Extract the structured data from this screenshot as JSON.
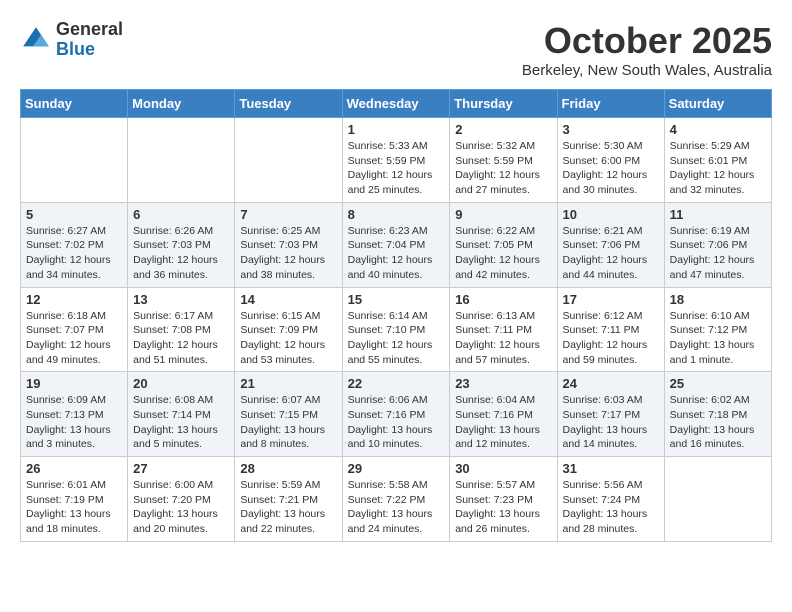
{
  "logo": {
    "general": "General",
    "blue": "Blue"
  },
  "title": "October 2025",
  "location": "Berkeley, New South Wales, Australia",
  "weekdays": [
    "Sunday",
    "Monday",
    "Tuesday",
    "Wednesday",
    "Thursday",
    "Friday",
    "Saturday"
  ],
  "weeks": [
    [
      {
        "day": "",
        "info": ""
      },
      {
        "day": "",
        "info": ""
      },
      {
        "day": "",
        "info": ""
      },
      {
        "day": "1",
        "info": "Sunrise: 5:33 AM\nSunset: 5:59 PM\nDaylight: 12 hours\nand 25 minutes."
      },
      {
        "day": "2",
        "info": "Sunrise: 5:32 AM\nSunset: 5:59 PM\nDaylight: 12 hours\nand 27 minutes."
      },
      {
        "day": "3",
        "info": "Sunrise: 5:30 AM\nSunset: 6:00 PM\nDaylight: 12 hours\nand 30 minutes."
      },
      {
        "day": "4",
        "info": "Sunrise: 5:29 AM\nSunset: 6:01 PM\nDaylight: 12 hours\nand 32 minutes."
      }
    ],
    [
      {
        "day": "5",
        "info": "Sunrise: 6:27 AM\nSunset: 7:02 PM\nDaylight: 12 hours\nand 34 minutes."
      },
      {
        "day": "6",
        "info": "Sunrise: 6:26 AM\nSunset: 7:03 PM\nDaylight: 12 hours\nand 36 minutes."
      },
      {
        "day": "7",
        "info": "Sunrise: 6:25 AM\nSunset: 7:03 PM\nDaylight: 12 hours\nand 38 minutes."
      },
      {
        "day": "8",
        "info": "Sunrise: 6:23 AM\nSunset: 7:04 PM\nDaylight: 12 hours\nand 40 minutes."
      },
      {
        "day": "9",
        "info": "Sunrise: 6:22 AM\nSunset: 7:05 PM\nDaylight: 12 hours\nand 42 minutes."
      },
      {
        "day": "10",
        "info": "Sunrise: 6:21 AM\nSunset: 7:06 PM\nDaylight: 12 hours\nand 44 minutes."
      },
      {
        "day": "11",
        "info": "Sunrise: 6:19 AM\nSunset: 7:06 PM\nDaylight: 12 hours\nand 47 minutes."
      }
    ],
    [
      {
        "day": "12",
        "info": "Sunrise: 6:18 AM\nSunset: 7:07 PM\nDaylight: 12 hours\nand 49 minutes."
      },
      {
        "day": "13",
        "info": "Sunrise: 6:17 AM\nSunset: 7:08 PM\nDaylight: 12 hours\nand 51 minutes."
      },
      {
        "day": "14",
        "info": "Sunrise: 6:15 AM\nSunset: 7:09 PM\nDaylight: 12 hours\nand 53 minutes."
      },
      {
        "day": "15",
        "info": "Sunrise: 6:14 AM\nSunset: 7:10 PM\nDaylight: 12 hours\nand 55 minutes."
      },
      {
        "day": "16",
        "info": "Sunrise: 6:13 AM\nSunset: 7:11 PM\nDaylight: 12 hours\nand 57 minutes."
      },
      {
        "day": "17",
        "info": "Sunrise: 6:12 AM\nSunset: 7:11 PM\nDaylight: 12 hours\nand 59 minutes."
      },
      {
        "day": "18",
        "info": "Sunrise: 6:10 AM\nSunset: 7:12 PM\nDaylight: 13 hours\nand 1 minute."
      }
    ],
    [
      {
        "day": "19",
        "info": "Sunrise: 6:09 AM\nSunset: 7:13 PM\nDaylight: 13 hours\nand 3 minutes."
      },
      {
        "day": "20",
        "info": "Sunrise: 6:08 AM\nSunset: 7:14 PM\nDaylight: 13 hours\nand 5 minutes."
      },
      {
        "day": "21",
        "info": "Sunrise: 6:07 AM\nSunset: 7:15 PM\nDaylight: 13 hours\nand 8 minutes."
      },
      {
        "day": "22",
        "info": "Sunrise: 6:06 AM\nSunset: 7:16 PM\nDaylight: 13 hours\nand 10 minutes."
      },
      {
        "day": "23",
        "info": "Sunrise: 6:04 AM\nSunset: 7:16 PM\nDaylight: 13 hours\nand 12 minutes."
      },
      {
        "day": "24",
        "info": "Sunrise: 6:03 AM\nSunset: 7:17 PM\nDaylight: 13 hours\nand 14 minutes."
      },
      {
        "day": "25",
        "info": "Sunrise: 6:02 AM\nSunset: 7:18 PM\nDaylight: 13 hours\nand 16 minutes."
      }
    ],
    [
      {
        "day": "26",
        "info": "Sunrise: 6:01 AM\nSunset: 7:19 PM\nDaylight: 13 hours\nand 18 minutes."
      },
      {
        "day": "27",
        "info": "Sunrise: 6:00 AM\nSunset: 7:20 PM\nDaylight: 13 hours\nand 20 minutes."
      },
      {
        "day": "28",
        "info": "Sunrise: 5:59 AM\nSunset: 7:21 PM\nDaylight: 13 hours\nand 22 minutes."
      },
      {
        "day": "29",
        "info": "Sunrise: 5:58 AM\nSunset: 7:22 PM\nDaylight: 13 hours\nand 24 minutes."
      },
      {
        "day": "30",
        "info": "Sunrise: 5:57 AM\nSunset: 7:23 PM\nDaylight: 13 hours\nand 26 minutes."
      },
      {
        "day": "31",
        "info": "Sunrise: 5:56 AM\nSunset: 7:24 PM\nDaylight: 13 hours\nand 28 minutes."
      },
      {
        "day": "",
        "info": ""
      }
    ]
  ]
}
